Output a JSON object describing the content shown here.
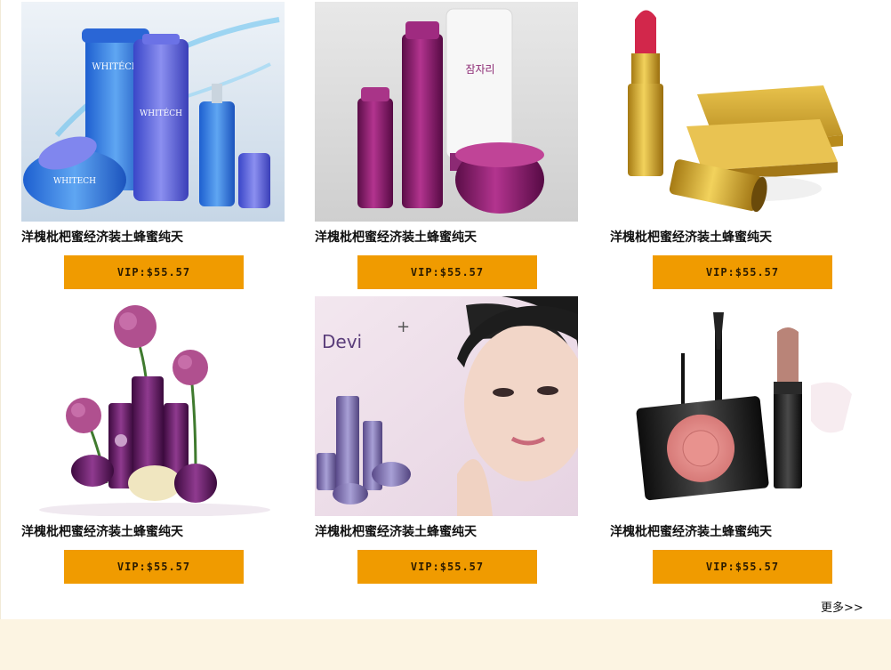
{
  "products": [
    {
      "title": "洋槐枇杷蜜经济装土蜂蜜纯天",
      "price_label": "VIP:$55.57",
      "image_icon": "skincare-blue-bottles-image"
    },
    {
      "title": "洋槐枇杷蜜经济装土蜂蜜纯天",
      "price_label": "VIP:$55.57",
      "image_icon": "skincare-purple-set-image"
    },
    {
      "title": "洋槐枇杷蜜经济装土蜂蜜纯天",
      "price_label": "VIP:$55.57",
      "image_icon": "lipstick-and-compact-image"
    },
    {
      "title": "洋槐枇杷蜜经济装土蜂蜜纯天",
      "price_label": "VIP:$55.57",
      "image_icon": "purple-cosmetics-with-flowers-image"
    },
    {
      "title": "洋槐枇杷蜜经济装土蜂蜜纯天",
      "price_label": "VIP:$55.57",
      "image_icon": "devi-model-portrait-image",
      "brand": "Devi"
    },
    {
      "title": "洋槐枇杷蜜经济装土蜂蜜纯天",
      "price_label": "VIP:$55.57",
      "image_icon": "makeup-lipstick-blush-image"
    }
  ],
  "more_label": "更多>>",
  "colors": {
    "price_button": "#f09b00",
    "footer_band": "#fcf4e2",
    "text": "#111111"
  }
}
